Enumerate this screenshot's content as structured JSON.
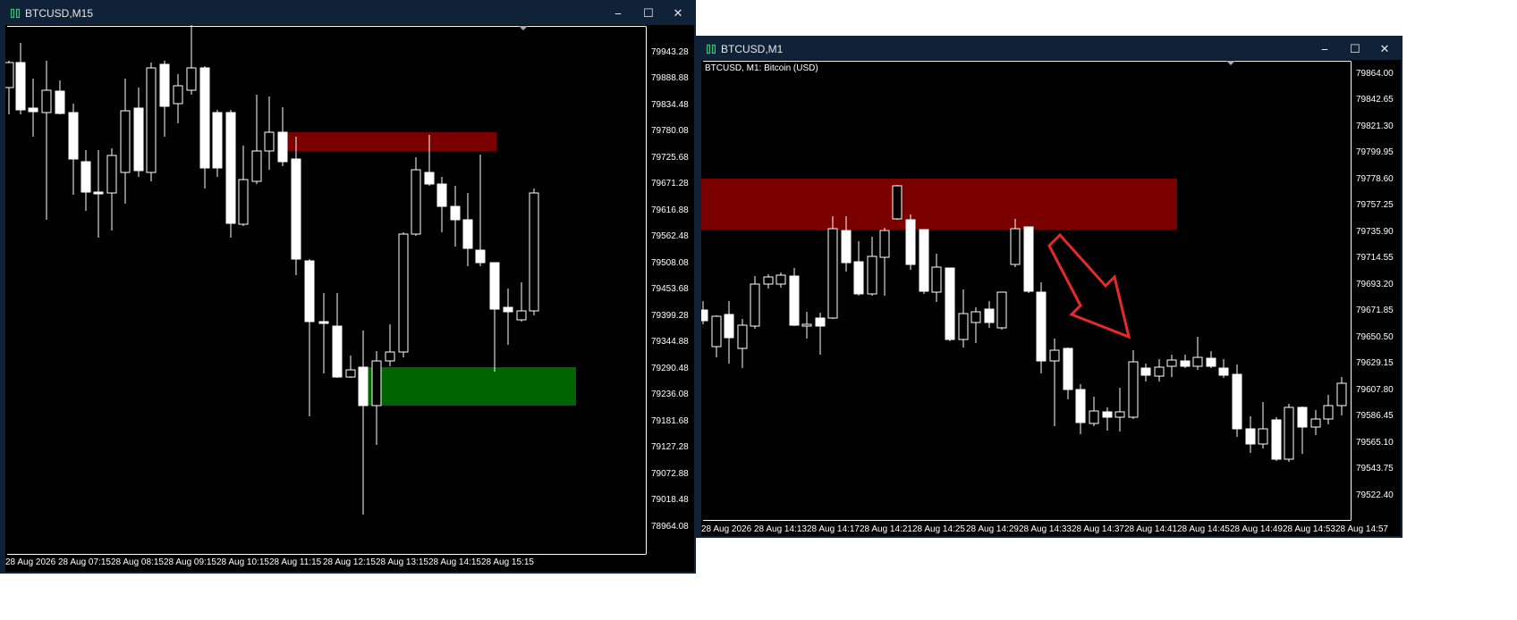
{
  "left_window": {
    "title": "BTCUSD,M15",
    "buttons": {
      "minimize": "⎯",
      "maximize": "☐",
      "close": "✕"
    },
    "colors": {
      "frame": "#0f2238",
      "zone_supply": "#7a0000",
      "zone_demand": "#006400",
      "candle": "#ffffff"
    },
    "price_labels": [
      "79943.28",
      "79888.88",
      "79834.48",
      "79780.08",
      "79725.68",
      "79671.28",
      "79616.88",
      "79562.48",
      "79508.08",
      "79453.68",
      "79399.28",
      "79344.88",
      "79290.48",
      "79236.08",
      "79181.68",
      "79127.28",
      "79072.88",
      "79018.48",
      "78964.08"
    ],
    "time_labels": [
      "28 Aug 2026",
      "28 Aug 07:15",
      "28 Aug 08:15",
      "28 Aug 09:15",
      "28 Aug 10:15",
      "28 Aug 11:15",
      "28 Aug 12:15",
      "28 Aug 13:15",
      "28 Aug 14:15",
      "28 Aug 15:15"
    ]
  },
  "right_window": {
    "title": "BTCUSD,M1",
    "info_text": "BTCUSD, M1:  Bitcoin (USD)",
    "buttons": {
      "minimize": "⎯",
      "maximize": "☐",
      "close": "✕"
    },
    "colors": {
      "frame": "#0f2238",
      "zone_supply": "#7a0000",
      "arrow": "#e8292a",
      "candle": "#ffffff"
    },
    "price_labels": [
      "79864.00",
      "79842.65",
      "79821.30",
      "79799.95",
      "79778.60",
      "79757.25",
      "79735.90",
      "79714.55",
      "79693.20",
      "79671.85",
      "79650.50",
      "79629.15",
      "79607.80",
      "79586.45",
      "79565.10",
      "79543.75",
      "79522.40"
    ],
    "time_labels": [
      "28 Aug 2026",
      "28 Aug 14:13",
      "28 Aug 14:17",
      "28 Aug 14:21",
      "28 Aug 14:25",
      "28 Aug 14:29",
      "28 Aug 14:33",
      "28 Aug 14:37",
      "28 Aug 14:41",
      "28 Aug 14:45",
      "28 Aug 14:49",
      "28 Aug 14:53",
      "28 Aug 14:57"
    ]
  }
}
